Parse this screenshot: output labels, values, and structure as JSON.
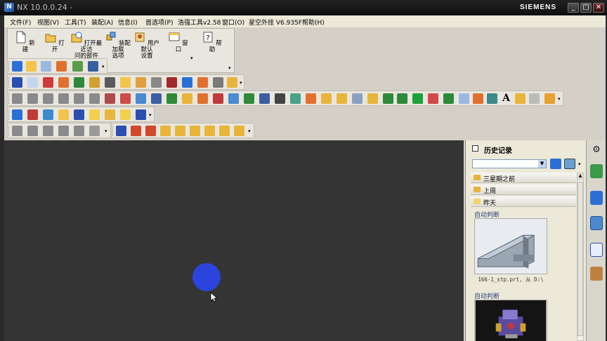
{
  "window": {
    "title": "NX 10.0.0.24 -",
    "brand": "SIEMENS",
    "controls": [
      "_",
      "□",
      "✕"
    ]
  },
  "menu": [
    "文件(F)",
    "视图(V)",
    "工具(T)",
    "装配(A)",
    "信息(I)",
    "首选项(P)",
    "浩强工具v2.58",
    "窗口(O)",
    "星空外挂 V6.935F",
    "帮助(H)"
  ],
  "standard_toolbar": {
    "new": "新建",
    "open": "打开",
    "open_recent_line1": "打开最近访",
    "open_recent_line2": "问的部件",
    "assembly_load_line1": "装配加载",
    "assembly_load_line2": "选项",
    "user_defaults_line1": "用户默认",
    "user_defaults_line2": "设置",
    "window": "窗口",
    "help": "帮助"
  },
  "history": {
    "title": "历史记录",
    "groups": [
      "三星期之前",
      "上周",
      "昨天"
    ],
    "entries": [
      {
        "label": "自动判断",
        "caption": "166-1_stp.prt, 从 D:\\"
      },
      {
        "label": "自动判断",
        "caption": ""
      }
    ]
  },
  "colors": {
    "canvas_bg": "#343434",
    "cursor_halo": "#2a44dd",
    "accent_blue": "#2b6fd6"
  }
}
